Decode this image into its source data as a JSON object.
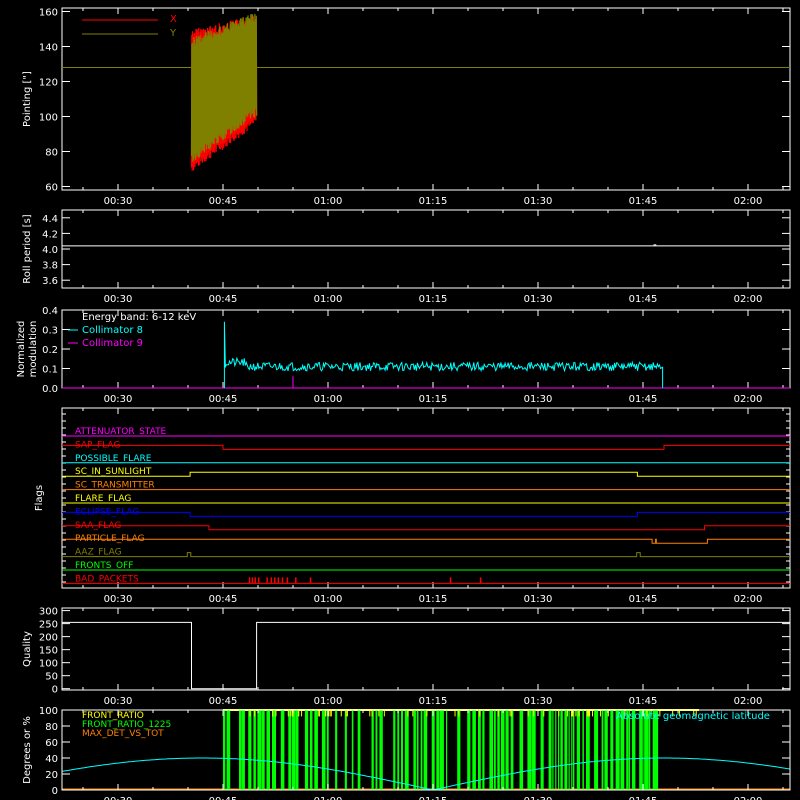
{
  "time_axis": {
    "tick_labels": [
      "00:30",
      "00:45",
      "01:00",
      "01:15",
      "01:30",
      "01:45",
      "02:00"
    ],
    "tick_minutes": [
      30,
      45,
      60,
      75,
      90,
      105,
      120
    ],
    "xlim_minutes": [
      22,
      126
    ]
  },
  "colors": {
    "background": "#000000",
    "axes": "#ffffff",
    "red": "#ff0000",
    "olive": "#808000",
    "white": "#ffffff",
    "cyan": "#00ffff",
    "magenta": "#ff00ff",
    "yellow": "#ffff00",
    "orange": "#ff8000",
    "blue": "#0000ff",
    "green": "#00ff00"
  },
  "chart_data": [
    {
      "id": "pointing",
      "type": "line",
      "ylabel": "Pointing [\"]",
      "ylim": [
        58,
        162
      ],
      "yticks": [
        60,
        80,
        100,
        120,
        140,
        160
      ],
      "legend": [
        "X",
        "Y"
      ],
      "series": [
        {
          "name": "X",
          "color": "#ff0000",
          "segment_minutes": [
            40.5,
            49.8
          ],
          "band_start": [
            68,
            150
          ],
          "band_end": [
            95,
            158
          ]
        },
        {
          "name": "Y",
          "color": "#808000",
          "segment_minutes": [
            40.5,
            49.8
          ],
          "band_start": [
            73,
            145
          ],
          "band_end": [
            100,
            160
          ],
          "baseline": 128
        }
      ]
    },
    {
      "id": "roll",
      "type": "line",
      "ylabel": "Roll period [s]",
      "ylim": [
        3.5,
        4.5
      ],
      "yticks": [
        3.6,
        3.8,
        4.0,
        4.2,
        4.4
      ],
      "ytick_labels": [
        "3.6",
        "3.8",
        "4.0",
        "4.2",
        "4.4"
      ],
      "series": [
        {
          "name": "",
          "color": "#ffffff",
          "value": 4.04
        }
      ]
    },
    {
      "id": "modulation",
      "type": "line",
      "ylabel": [
        "Normalized",
        "modulation"
      ],
      "ylim": [
        0,
        0.4
      ],
      "yticks": [
        0.0,
        0.1,
        0.2,
        0.3,
        0.4
      ],
      "ytick_labels": [
        "0.0",
        "0.1",
        "0.2",
        "0.3",
        "0.4"
      ],
      "legend_title": "Energy band: 6-12 keV",
      "series": [
        {
          "name": "Collimator 8",
          "color": "#00ffff",
          "start_minute": 45.2,
          "end_minute": 107.8,
          "spike": 0.34,
          "level": 0.11
        },
        {
          "name": "Collimator 9",
          "color": "#ff00ff",
          "value": 0.0,
          "spike_minute": 55.0,
          "spike_value": 0.06
        }
      ]
    },
    {
      "id": "flags",
      "type": "line",
      "ylabel": "Flags",
      "series": [
        {
          "name": "ATTENUATOR_STATE",
          "color": "#ff00ff",
          "steps": [
            [
              22,
              0
            ]
          ]
        },
        {
          "name": "SAP_FLAG",
          "color": "#ff0000",
          "steps": [
            [
              22,
              1
            ],
            [
              45,
              0
            ],
            [
              108,
              1
            ]
          ]
        },
        {
          "name": "POSSIBLE_FLARE",
          "color": "#00ffff",
          "steps": [
            [
              22,
              0
            ]
          ]
        },
        {
          "name": "SC_IN_SUNLIGHT",
          "color": "#ffff00",
          "steps": [
            [
              22,
              0
            ],
            [
              40.3,
              1
            ],
            [
              104.2,
              0
            ]
          ]
        },
        {
          "name": "SC_TRANSMITTER",
          "color": "#ff8000",
          "steps": [
            [
              22,
              0
            ]
          ]
        },
        {
          "name": "FLARE_FLAG",
          "color": "#ffff00",
          "steps": [
            [
              22,
              0
            ]
          ]
        },
        {
          "name": "ECLIPSE_FLAG",
          "color": "#0000ff",
          "steps": [
            [
              22,
              1
            ],
            [
              40.3,
              0
            ],
            [
              104.2,
              1
            ]
          ]
        },
        {
          "name": "SAA_FLAG",
          "color": "#ff0000",
          "steps": [
            [
              22,
              1
            ],
            [
              43.0,
              0
            ],
            [
              113.8,
              1
            ]
          ]
        },
        {
          "name": "PARTICLE_FLAG",
          "color": "#ff8000",
          "steps": [
            [
              22,
              1
            ],
            [
              106.3,
              0
            ],
            [
              106.8,
              1
            ],
            [
              106.9,
              0
            ],
            [
              114.2,
              1
            ]
          ]
        },
        {
          "name": "AAZ_FLAG",
          "color": "#808000",
          "steps": [
            [
              22,
              0
            ],
            [
              39.9,
              1
            ],
            [
              40.4,
              0
            ],
            [
              104.1,
              1
            ],
            [
              104.6,
              0
            ]
          ]
        },
        {
          "name": "FRONTS_OFF",
          "color": "#00ff00",
          "steps": [
            [
              22,
              0
            ]
          ]
        },
        {
          "name": "BAD_PACKETS",
          "color": "#ff0000",
          "baseline": 0,
          "spikes": [
            48.8,
            49.2,
            49.6,
            50.1,
            51.3,
            51.9,
            52.4,
            52.9,
            53.5,
            54.2,
            55.4,
            57.5,
            77.5,
            81.8
          ]
        }
      ]
    },
    {
      "id": "quality",
      "type": "line",
      "ylabel": "Quality",
      "ylim": [
        -5,
        310
      ],
      "yticks": [
        0,
        50,
        100,
        150,
        200,
        250,
        300
      ],
      "series": [
        {
          "name": "",
          "color": "#ffffff",
          "steps": [
            [
              22,
              255
            ],
            [
              40.5,
              0
            ],
            [
              49.8,
              255
            ]
          ]
        }
      ]
    },
    {
      "id": "geo",
      "type": "line",
      "ylabel": "Degrees or %",
      "ylim": [
        0,
        100
      ],
      "yticks": [
        0,
        20,
        40,
        60,
        80,
        100
      ],
      "annotation": "Absolute geomagnetic latitude",
      "series": [
        {
          "name": "FRONT_RATIO",
          "color": "#ffff00",
          "start_minute": 45.0,
          "end_minute": 113.0,
          "level": 100
        },
        {
          "name": "FRONT_RATIO_1225",
          "color": "#00ff00",
          "start_minute": 45.0,
          "end_minute": 107.8,
          "level": 100
        },
        {
          "name": "MAX_DET_VS_TOT",
          "color": "#ff8000",
          "value": 0
        },
        {
          "name": "Absolute geomagnetic latitude",
          "color": "#00ffff",
          "min": 0,
          "max": 40
        }
      ]
    }
  ]
}
